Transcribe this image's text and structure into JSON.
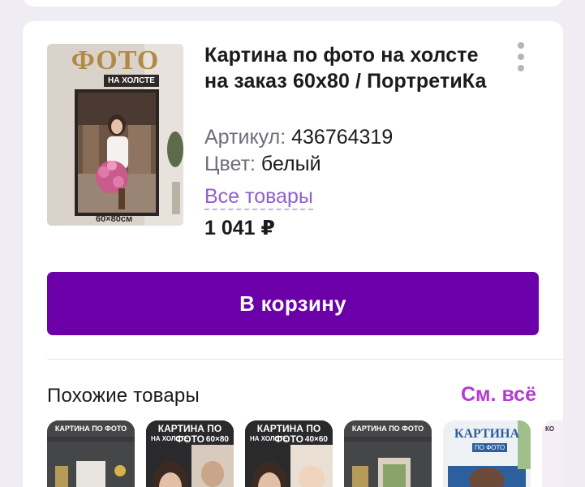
{
  "product": {
    "image": {
      "logo_text": "ФОТО",
      "sub_text": "НА ХОЛСТЕ",
      "size_text": "60×80см"
    },
    "title": "Картина по фото на холсте на заказ 60х80 / ПортретиКа",
    "article_label": "Артикул:",
    "article_value": "436764319",
    "color_label": "Цвет:",
    "color_value": "белый",
    "all_goods_link": "Все товары",
    "price": "1 041 ₽",
    "menu_icon": "more-vertical-icon"
  },
  "actions": {
    "add_to_cart_label": "В корзину"
  },
  "similar": {
    "title": "Похожие товары",
    "see_all_label": "См. всё",
    "items": [
      {
        "label": "КАРТИНА ПО ФОТО"
      },
      {
        "label": "КАРТИНА ПО ФОТО",
        "sub": "НА ХОЛСТЕ",
        "size": "60×80"
      },
      {
        "label": "КАРТИНА ПО ФОТО",
        "sub": "НА ХОЛСТЕ",
        "size": "40×60"
      },
      {
        "label": "КАРТИНА ПО ФОТО"
      },
      {
        "label": "КАРТИНА",
        "sub": "ПО ФОТО"
      },
      {
        "label": "КО"
      }
    ]
  },
  "colors": {
    "accent": "#6c00a8",
    "link": "#8f5fd0",
    "see_all": "#b53ad1"
  }
}
